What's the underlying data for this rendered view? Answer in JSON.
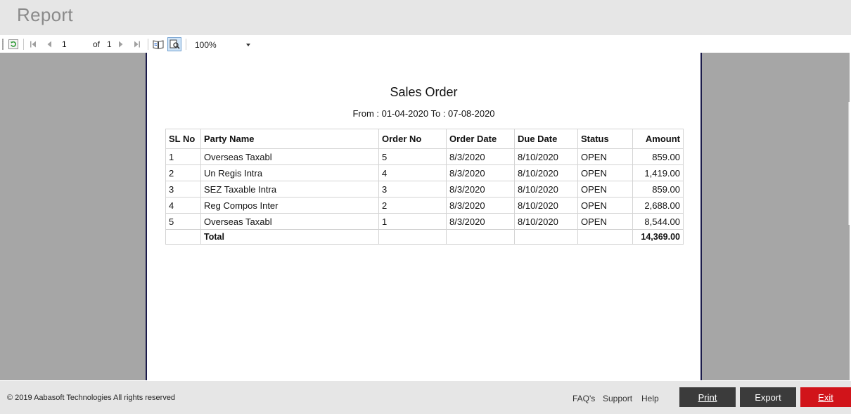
{
  "app": {
    "title": "Report"
  },
  "toolbar": {
    "current_page": "1",
    "of_label": "of",
    "total_pages": "1",
    "zoom": "100%",
    "icons": [
      "refresh-icon",
      "first-page-icon",
      "previous-page-icon",
      "next-page-icon",
      "last-page-icon",
      "document-map-icon",
      "print-preview-icon"
    ]
  },
  "report": {
    "title": "Sales Order",
    "subtitle": "From : 01-04-2020 To : 07-08-2020",
    "columns": [
      "SL No",
      "Party Name",
      "Order No",
      "Order Date",
      "Due Date",
      "Status",
      "Amount"
    ],
    "rows": [
      [
        "1",
        "Overseas Taxabl",
        "5",
        "8/3/2020",
        "8/10/2020",
        "OPEN",
        "859.00"
      ],
      [
        "2",
        "Un Regis Intra",
        "4",
        "8/3/2020",
        "8/10/2020",
        "OPEN",
        "1,419.00"
      ],
      [
        "3",
        "SEZ Taxable Intra",
        "3",
        "8/3/2020",
        "8/10/2020",
        "OPEN",
        "859.00"
      ],
      [
        "4",
        "Reg Compos Inter",
        "2",
        "8/3/2020",
        "8/10/2020",
        "OPEN",
        "2,688.00"
      ],
      [
        "5",
        "Overseas Taxabl",
        "1",
        "8/3/2020",
        "8/10/2020",
        "OPEN",
        "8,544.00"
      ]
    ],
    "total_label": "Total",
    "total_amount": "14,369.00"
  },
  "footer": {
    "copyright": "© 2019 Aabasoft Technologies All rights reserved",
    "links": [
      "FAQ's",
      "Support",
      "Help"
    ],
    "print_label": "Print",
    "export_label": "Export",
    "exit_label": "Exit"
  },
  "colors": {
    "exit_button": "#d1141a",
    "dark_button": "#3b3b3b",
    "viewer_background": "#a6a6a6",
    "page_border": "#1b1b4a"
  }
}
